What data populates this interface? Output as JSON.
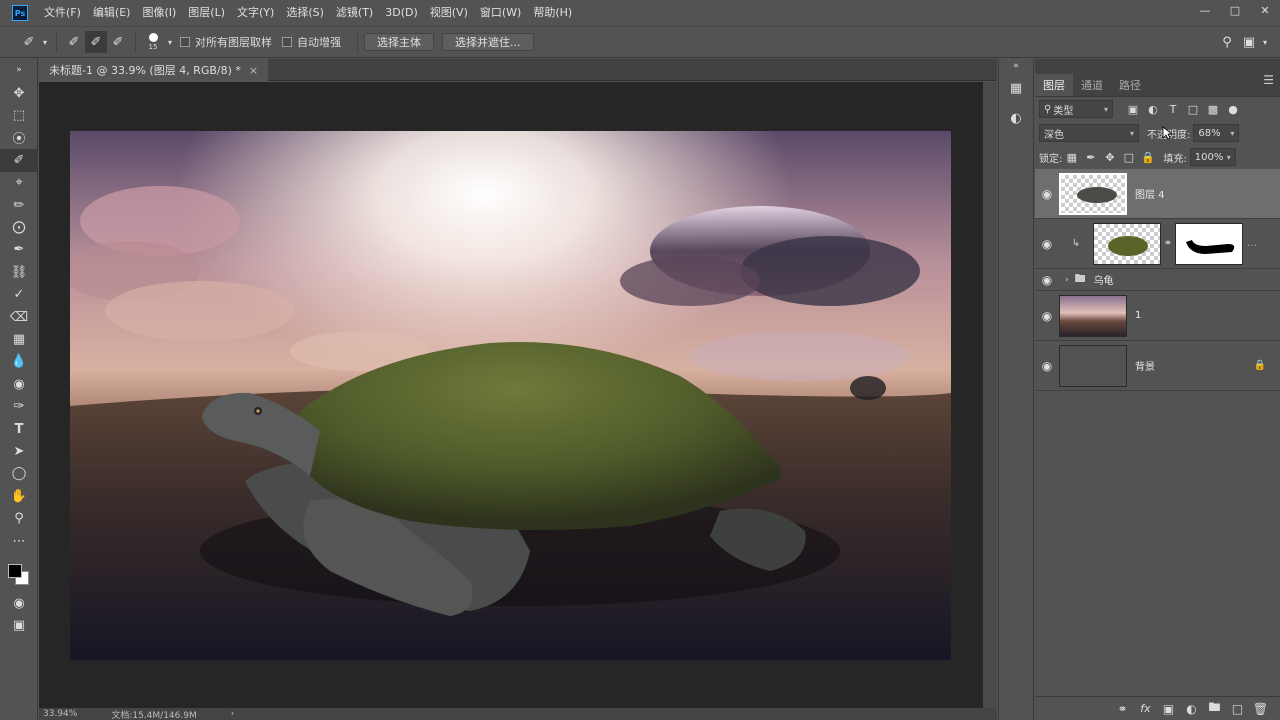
{
  "app": {
    "logo": "Ps",
    "menus": [
      "文件(F)",
      "编辑(E)",
      "图像(I)",
      "图层(L)",
      "文字(Y)",
      "选择(S)",
      "滤镜(T)",
      "3D(D)",
      "视图(V)",
      "窗口(W)",
      "帮助(H)"
    ],
    "window_controls": [
      "minimize-icon",
      "maximize-icon",
      "close-icon"
    ]
  },
  "options": {
    "brush_size": "15",
    "sample_all_layers": "对所有图层取样",
    "auto_enhance": "自动增强",
    "select_subject": "选择主体",
    "select_and_mask": "选择并遮住..."
  },
  "document": {
    "tab_title": "未标题-1 @ 33.9% (图层 4, RGB/8) *",
    "zoom": "33.94%",
    "doc_info": "文档:15.4M/146.9M"
  },
  "layers_panel": {
    "tabs": [
      "图层",
      "通道",
      "路径"
    ],
    "filter_kind": "类型",
    "blend_mode": "深色",
    "opacity_label": "不透明度:",
    "opacity_value": "68%",
    "lock_label": "锁定:",
    "fill_label": "填充:",
    "fill_value": "100%",
    "layers": [
      {
        "name": "图层 4",
        "selected": true
      },
      {
        "name": "",
        "clipped": true,
        "has_mask": true
      },
      {
        "name": "乌龟",
        "type": "group"
      },
      {
        "name": "1"
      },
      {
        "name": "背景",
        "locked": true
      }
    ]
  },
  "colors": {
    "ui_bg": "#535353",
    "canvas_bg": "#262626",
    "accent": "#31a8ff"
  }
}
